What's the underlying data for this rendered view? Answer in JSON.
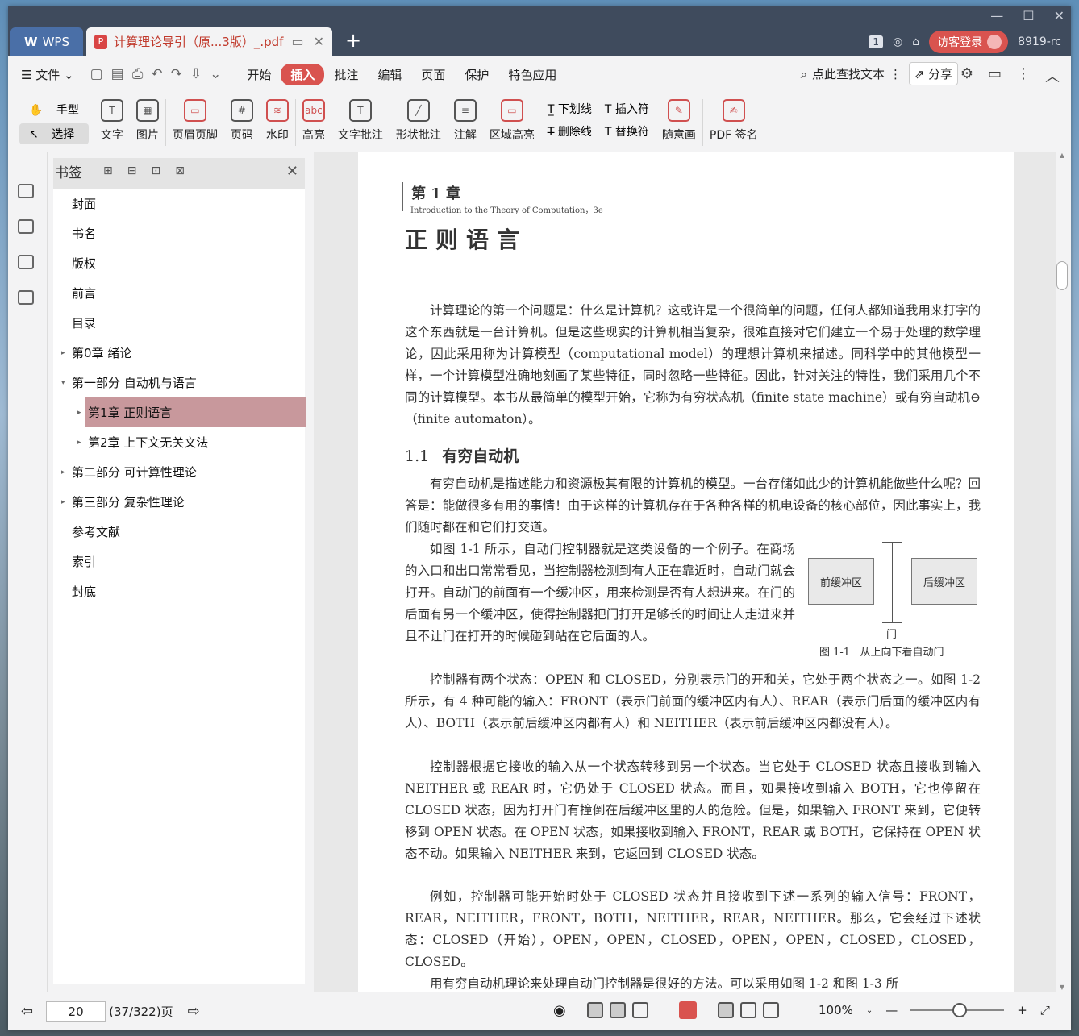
{
  "titlebar": {
    "app_name": "WPS",
    "doc_tab_title": "计算理论导引（原...3版）_.pdf",
    "page_badge": "1",
    "login_label": "访客登录",
    "user_id": "8919-rc"
  },
  "menu": {
    "file": "文件",
    "tabs": [
      "开始",
      "插入",
      "批注",
      "编辑",
      "页面",
      "保护",
      "特色应用"
    ],
    "active_tab": "插入",
    "search_label": "点此查找文本",
    "share_label": "分享"
  },
  "ribbon": {
    "hand": "手型",
    "select": "选择",
    "text": "文字",
    "image": "图片",
    "header_footer": "页眉页脚",
    "page_num": "页码",
    "watermark": "水印",
    "highlight": "高亮",
    "text_comment": "文字批注",
    "shape_comment": "形状批注",
    "note": "注解",
    "area_highlight": "区域高亮",
    "underline": "下划线",
    "strikethrough": "删除线",
    "insert_char": "插入符",
    "replace_char": "替换符",
    "freehand": "随意画",
    "pdf_sign": "PDF 签名"
  },
  "bookmarks": {
    "title": "书签",
    "items": [
      {
        "label": "封面",
        "level": 0,
        "arrow": ""
      },
      {
        "label": "书名",
        "level": 0,
        "arrow": ""
      },
      {
        "label": "版权",
        "level": 0,
        "arrow": ""
      },
      {
        "label": "前言",
        "level": 0,
        "arrow": ""
      },
      {
        "label": "目录",
        "level": 0,
        "arrow": ""
      },
      {
        "label": "第0章 绪论",
        "level": 0,
        "arrow": "▸"
      },
      {
        "label": "第一部分 自动机与语言",
        "level": 0,
        "arrow": "▾"
      },
      {
        "label": "第1章 正则语言",
        "level": 1,
        "arrow": "▸",
        "selected": true
      },
      {
        "label": "第2章 上下文无关文法",
        "level": 1,
        "arrow": "▸"
      },
      {
        "label": "第二部分 可计算性理论",
        "level": 0,
        "arrow": "▸"
      },
      {
        "label": "第三部分 复杂性理论",
        "level": 0,
        "arrow": "▸"
      },
      {
        "label": "参考文献",
        "level": 0,
        "arrow": ""
      },
      {
        "label": "索引",
        "level": 0,
        "arrow": ""
      },
      {
        "label": "封底",
        "level": 0,
        "arrow": ""
      }
    ]
  },
  "document": {
    "chapter_num": "第 1 章",
    "chapter_sub": "Introduction to the Theory of Computation，3e",
    "chapter_title": "正则语言",
    "para1": "计算理论的第一个问题是：什么是计算机？这或许是一个很简单的问题，任何人都知道我用来打字的这个东西就是一台计算机。但是这些现实的计算机相当复杂，很难直接对它们建立一个易于处理的数学理论，因此采用称为计算模型（computational model）的理想计算机来描述。同科学中的其他模型一样，一个计算模型准确地刻画了某些特征，同时忽略一些特征。因此，针对关注的特性，我们采用几个不同的计算模型。本书从最简单的模型开始，它称为有穷状态机（finite state machine）或有穷自动机⊖（finite automaton）。",
    "section_num": "1.1",
    "section_title": "有穷自动机",
    "para2": "有穷自动机是描述能力和资源极其有限的计算机的模型。一台存储如此少的计算机能做些什么呢？回答是：能做很多有用的事情！由于这样的计算机存在于各种各样的机电设备的核心部位，因此事实上，我们随时都在和它们打交道。",
    "para3": "如图 1-1 所示，自动门控制器就是这类设备的一个例子。在商场的入口和出口常常看见，当控制器检测到有人正在靠近时，自动门就会打开。自动门的前面有一个缓冲区，用来检测是否有人想进来。在门的后面有另一个缓冲区，使得控制器把门打开足够长的时间让人走进来并且不让门在打开的时候碰到站在它后面的人。",
    "fig_front": "前缓冲区",
    "fig_back": "后缓冲区",
    "fig_door": "门",
    "fig_caption": "图 1-1   从上向下看自动门",
    "para4": "控制器有两个状态：OPEN 和 CLOSED，分别表示门的开和关，它处于两个状态之一。如图 1-2 所示，有 4 种可能的输入：FRONT（表示门前面的缓冲区内有人）、REAR（表示门后面的缓冲区内有人）、BOTH（表示前后缓冲区内都有人）和 NEITHER（表示前后缓冲区内都没有人）。",
    "para5": "控制器根据它接收的输入从一个状态转移到另一个状态。当它处于 CLOSED 状态且接收到输入 NEITHER 或 REAR 时，它仍处于 CLOSED 状态。而且，如果接收到输入 BOTH，它也停留在 CLOSED 状态，因为打开门有撞倒在后缓冲区里的人的危险。但是，如果输入 FRONT 来到，它便转移到 OPEN 状态。在 OPEN 状态，如果接收到输入 FRONT，REAR 或 BOTH，它保持在 OPEN 状态不动。如果输入 NEITHER 来到，它返回到 CLOSED 状态。",
    "para6": "例如，控制器可能开始时处于 CLOSED 状态并且接收到下述一系列的输入信号：FRONT，REAR，NEITHER，FRONT，BOTH，NEITHER，REAR，NEITHER。那么，它会经过下述状态：CLOSED（开始），OPEN，OPEN，CLOSED，OPEN，OPEN，CLOSED，CLOSED，CLOSED。",
    "para7": "用有穷自动机理论来处理自动门控制器是很好的方法。可以采用如图 1-2 和图 1-3 所"
  },
  "status": {
    "page_input": "20",
    "page_info": "(37/322)",
    "page_unit": "页",
    "zoom": "100%"
  }
}
